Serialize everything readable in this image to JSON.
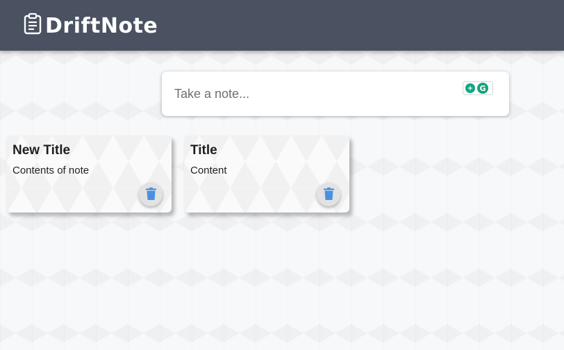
{
  "app": {
    "title": "DriftNote",
    "header_color": "#4a5160",
    "logo_icon": "clipboard-icon"
  },
  "composer": {
    "placeholder": "Take a note...",
    "value": "",
    "extension_icons": [
      "grammar-assistant-icon",
      "grammarly-icon"
    ]
  },
  "notes": [
    {
      "title": "New Title",
      "content": "Contents of note",
      "delete_icon": "trash-icon"
    },
    {
      "title": "Title",
      "content": "Content",
      "delete_icon": "trash-icon"
    }
  ],
  "colors": {
    "accent_icon": "#4a90e2",
    "extension_green": "#11a683"
  }
}
